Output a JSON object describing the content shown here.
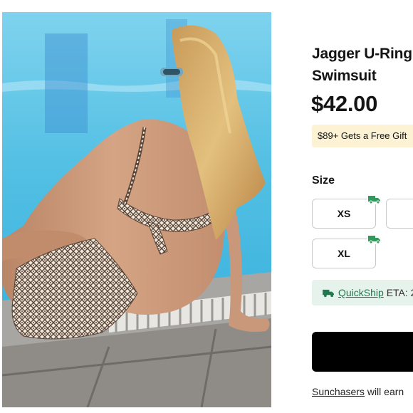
{
  "product": {
    "title_line1": "Jagger U-Ring",
    "title_line2": "Swimsuit",
    "price": "$42.00",
    "image_icon": "product-photo"
  },
  "promo": {
    "text": "$89+ Gets a Free Gift"
  },
  "size_selector": {
    "label": "Size",
    "options": [
      {
        "label": "XS",
        "quickship": true
      },
      {
        "label": "",
        "quickship": false
      },
      {
        "label": "XL",
        "quickship": true
      }
    ],
    "badge_icon": "truck-icon"
  },
  "quickship": {
    "icon": "truck-icon",
    "link": "QuickShip",
    "text": " ETA: 2"
  },
  "add_to_cart": {
    "label": ""
  },
  "sunchasers": {
    "link": "Sunchasers",
    "text": " will earn"
  },
  "colors": {
    "accent_green": "#1e7a4c",
    "quickship_bg": "#e6f2ec",
    "promo_bg": "#fdf3d4",
    "primary_button": "#000000"
  }
}
